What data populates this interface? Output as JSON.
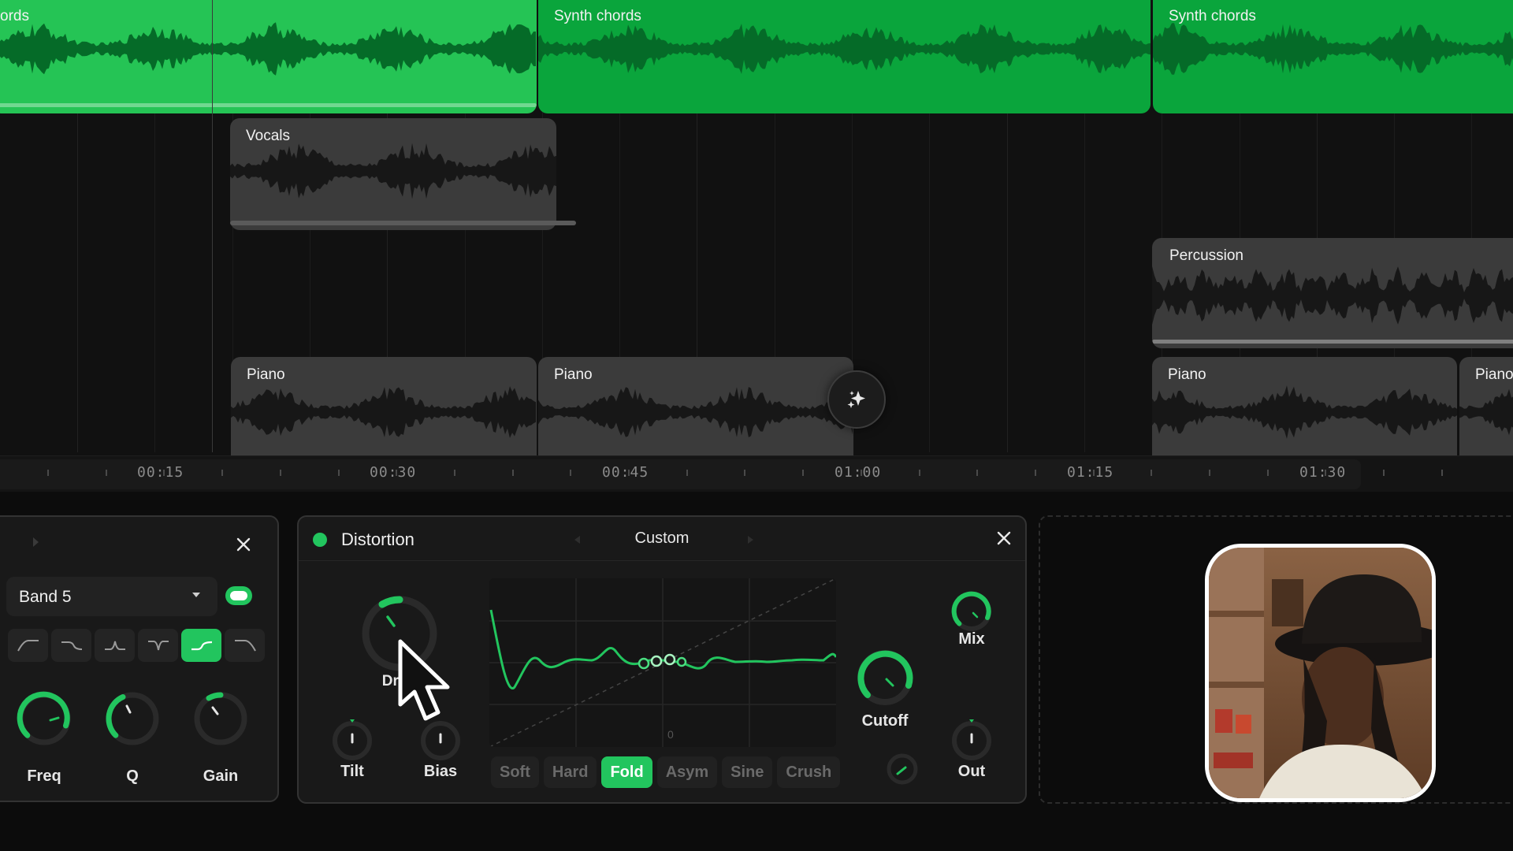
{
  "arrangement": {
    "clips": [
      {
        "id": "synth-1",
        "name": "ords",
        "style": "green light"
      },
      {
        "id": "synth-2",
        "name": "Synth chords",
        "style": "green"
      },
      {
        "id": "synth-3",
        "name": "Synth chords",
        "style": "green"
      },
      {
        "id": "vocals",
        "name": "Vocals",
        "style": "gray"
      },
      {
        "id": "percussion",
        "name": "Percussion",
        "style": "gray"
      },
      {
        "id": "piano-1",
        "name": "Piano",
        "style": "gray"
      },
      {
        "id": "piano-2",
        "name": "Piano",
        "style": "gray"
      },
      {
        "id": "piano-3",
        "name": "Piano",
        "style": "gray"
      },
      {
        "id": "piano-4",
        "name": "Piano",
        "style": "gray"
      }
    ],
    "sparkle_icon": "sparkle-icon"
  },
  "ruler": {
    "labels": [
      "00:15",
      "00:30",
      "00:45",
      "01:00",
      "01:15",
      "01:30"
    ]
  },
  "eq": {
    "band": "Band 5",
    "enabled": true,
    "filter_types": [
      "highpass-icon",
      "lowshelf-icon",
      "bell-icon",
      "notch-icon",
      "highshelf-icon",
      "lowpass-icon"
    ],
    "active_filter_index": 4,
    "knobs": {
      "freq": "Freq",
      "q": "Q",
      "gain": "Gain"
    }
  },
  "distortion": {
    "title": "Distortion",
    "preset": "Custom",
    "knobs": {
      "drive": "Dri",
      "tilt": "Tilt",
      "bias": "Bias",
      "mix": "Mix",
      "cutoff": "Cutoff",
      "out": "Out"
    },
    "graph_zero": "0",
    "modes": [
      "Soft",
      "Hard",
      "Fold",
      "Asym",
      "Sine",
      "Crush"
    ],
    "active_mode": "Fold"
  },
  "colors": {
    "accent": "#22c55e",
    "clip_green": "#0aa53c",
    "clip_green_light": "#25c455",
    "clip_gray": "#3b3b3b"
  }
}
